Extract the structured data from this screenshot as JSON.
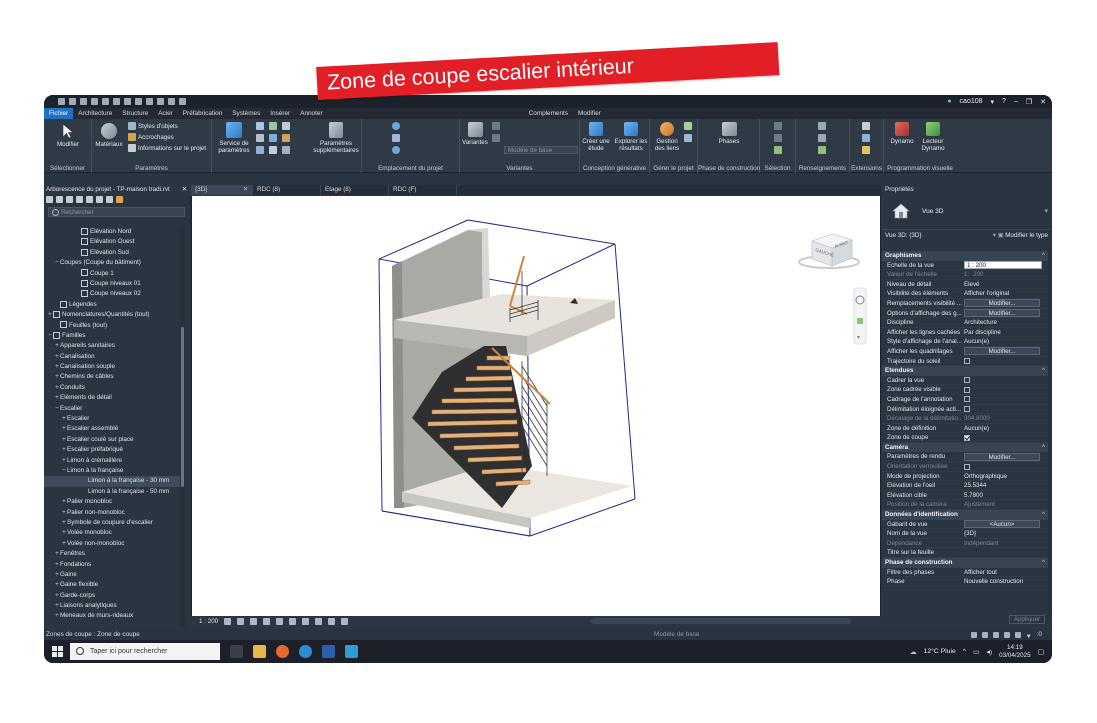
{
  "banner": {
    "text": "Zone de coupe escalier intérieur"
  },
  "titlebar": {
    "user": "cao108"
  },
  "ribbon_tabs": [
    "Fichier",
    "Architecture",
    "Structure",
    "Acier",
    "Préfabrication",
    "Systèmes",
    "Insérer",
    "Annoter",
    "Complements",
    "Modifier"
  ],
  "ribbon": {
    "modifier": "Modifier",
    "materiaux": "Matériaux",
    "styles_objets": "Styles d'objets",
    "accrochages": "Accrochages",
    "infos_projet": "Informations sur le projet",
    "service": "Service de paramètres",
    "params_supp": "Paramètres supplémentaires",
    "variantes": "Variantes",
    "modele_de_base": "Modèle de base",
    "creer_etude": "Créer une étude",
    "explorer": "Explorer les résultats",
    "gestion_liens": "Gestion des liens",
    "phases": "Phases",
    "dynamo": "Dynamo",
    "lecteur_dynamo": "Lecteur Dynamo",
    "panel_labels": {
      "selectionner": "Sélectionner",
      "parametres": "Paramètres",
      "emplacement": "Emplacement du projet",
      "variantes": "Variantes",
      "conception": "Conception générative",
      "gerer_projet": "Gérer le projet",
      "phase": "Phase de construction",
      "selection": "Sélection",
      "renseignements": "Renseignements",
      "extensions": "Extensions",
      "programmation": "Programmation visuelle"
    }
  },
  "browser": {
    "title": "Arborescence du projet - TP-maison tradi.rvt",
    "search_placeholder": "Rechercher",
    "items": [
      {
        "label": "Elévation Nord",
        "indent": 4,
        "exp": "",
        "icon": true
      },
      {
        "label": "Elévation Ouest",
        "indent": 4,
        "exp": "",
        "icon": true
      },
      {
        "label": "Elévation Sud",
        "indent": 4,
        "exp": "",
        "icon": true
      },
      {
        "label": "Coupes (Coupe du bâtiment)",
        "indent": 1,
        "exp": "−",
        "icon": false
      },
      {
        "label": "Coupe 1",
        "indent": 4,
        "exp": "",
        "icon": true
      },
      {
        "label": "Coupe niveaux 01",
        "indent": 4,
        "exp": "",
        "icon": true
      },
      {
        "label": "Coupe niveaux 02",
        "indent": 4,
        "exp": "",
        "icon": true
      },
      {
        "label": "Légendes",
        "indent": 1,
        "exp": "",
        "icon": true
      },
      {
        "label": "Nomenclatures/Quantités (tout)",
        "indent": 0,
        "exp": "+",
        "icon": true
      },
      {
        "label": "Feuilles (tout)",
        "indent": 1,
        "exp": "",
        "icon": true
      },
      {
        "label": "Familles",
        "indent": 0,
        "exp": "−",
        "icon": true
      },
      {
        "label": "Appareils sanitaires",
        "indent": 1,
        "exp": "+",
        "icon": false
      },
      {
        "label": "Canalisation",
        "indent": 1,
        "exp": "+",
        "icon": false
      },
      {
        "label": "Canalisation souple",
        "indent": 1,
        "exp": "+",
        "icon": false
      },
      {
        "label": "Chemins de câbles",
        "indent": 1,
        "exp": "+",
        "icon": false
      },
      {
        "label": "Conduits",
        "indent": 1,
        "exp": "+",
        "icon": false
      },
      {
        "label": "Eléments de détail",
        "indent": 1,
        "exp": "+",
        "icon": false
      },
      {
        "label": "Escalier",
        "indent": 1,
        "exp": "−",
        "icon": false
      },
      {
        "label": "Escalier",
        "indent": 2,
        "exp": "+",
        "icon": false
      },
      {
        "label": "Escalier assemblé",
        "indent": 2,
        "exp": "+",
        "icon": false
      },
      {
        "label": "Escalier coulé sur place",
        "indent": 2,
        "exp": "+",
        "icon": false
      },
      {
        "label": "Escalier préfabriqué",
        "indent": 2,
        "exp": "+",
        "icon": false
      },
      {
        "label": "Limon à crémaillère",
        "indent": 2,
        "exp": "+",
        "icon": false
      },
      {
        "label": "Limon à la française",
        "indent": 2,
        "exp": "−",
        "icon": false
      },
      {
        "label": "Limon à la française - 30 mm",
        "indent": 5,
        "exp": "",
        "icon": false,
        "sel": true
      },
      {
        "label": "Limon à la française - 50 mm",
        "indent": 5,
        "exp": "",
        "icon": false
      },
      {
        "label": "Palier monobloc",
        "indent": 2,
        "exp": "+",
        "icon": false
      },
      {
        "label": "Palier non-monobloc",
        "indent": 2,
        "exp": "+",
        "icon": false
      },
      {
        "label": "Symbole de coupure d'escalier",
        "indent": 2,
        "exp": "+",
        "icon": false
      },
      {
        "label": "Volée monobloc",
        "indent": 2,
        "exp": "+",
        "icon": false
      },
      {
        "label": "Volée non-monobloc",
        "indent": 2,
        "exp": "+",
        "icon": false
      },
      {
        "label": "Fenêtres",
        "indent": 1,
        "exp": "+",
        "icon": false
      },
      {
        "label": "Fondations",
        "indent": 1,
        "exp": "+",
        "icon": false
      },
      {
        "label": "Gaine",
        "indent": 1,
        "exp": "+",
        "icon": false
      },
      {
        "label": "Gaine flexible",
        "indent": 1,
        "exp": "+",
        "icon": false
      },
      {
        "label": "Garde-corps",
        "indent": 1,
        "exp": "+",
        "icon": false
      },
      {
        "label": "Liaisons analytiques",
        "indent": 1,
        "exp": "+",
        "icon": false
      },
      {
        "label": "Meneaux de murs-rideaux",
        "indent": 1,
        "exp": "+",
        "icon": false
      }
    ]
  },
  "view_tabs": [
    "{3D}",
    "RDC (8)",
    "Etage (8)",
    "RDC (F)"
  ],
  "viewcube": {
    "left": "GAUCHE",
    "front": "AVANT"
  },
  "view_scale": "1 : 200",
  "properties": {
    "title": "Propriétés",
    "type_name": "Vue 3D",
    "selector": "Vue 3D: {3D}",
    "edit_type": "Modifier le type",
    "apply": "Appliquer",
    "sections": [
      {
        "name": "Graphismes",
        "rows": [
          {
            "k": "Echelle de la vue",
            "v": "1 : 200",
            "kind": "field"
          },
          {
            "k": "Valeur de l'échelle",
            "v": "200",
            "kind": "dim",
            "pre": "1:"
          },
          {
            "k": "Niveau de détail",
            "v": "Elevé"
          },
          {
            "k": "Visibilité des éléments",
            "v": "Afficher l'original"
          },
          {
            "k": "Remplacements visibilité ...",
            "v": "Modifier...",
            "kind": "btn"
          },
          {
            "k": "Options d'affichage des g...",
            "v": "Modifier...",
            "kind": "btn"
          },
          {
            "k": "Discipline",
            "v": "Architecture"
          },
          {
            "k": "Afficher les lignes cachées",
            "v": "Par discipline"
          },
          {
            "k": "Style d'affichage de l'anal...",
            "v": "Aucun(e)"
          },
          {
            "k": "Afficher les quadrillages",
            "v": "Modifier...",
            "kind": "btn"
          },
          {
            "k": "Trajectoire du soleil",
            "v": "",
            "kind": "cb"
          }
        ]
      },
      {
        "name": "Etendues",
        "rows": [
          {
            "k": "Cadrer la vue",
            "v": "",
            "kind": "cb"
          },
          {
            "k": "Zone cadrée visible",
            "v": "",
            "kind": "cb"
          },
          {
            "k": "Cadrage de l'annotation",
            "v": "",
            "kind": "cb"
          },
          {
            "k": "Délimitation éloignée acti...",
            "v": "",
            "kind": "cb"
          },
          {
            "k": "Décalage de la délimitatio...",
            "v": "304.8000",
            "kind": "dim"
          },
          {
            "k": "Zone de définition",
            "v": "Aucun(e)"
          },
          {
            "k": "Zone de coupe",
            "v": "",
            "kind": "cbon"
          }
        ]
      },
      {
        "name": "Caméra",
        "rows": [
          {
            "k": "Paramètres de rendu",
            "v": "Modifier...",
            "kind": "btn"
          },
          {
            "k": "Orientation verrouillée",
            "v": "",
            "kind": "cbdim"
          },
          {
            "k": "Mode de projection",
            "v": "Orthographique"
          },
          {
            "k": "Elévation de l'oeil",
            "v": "25.5344"
          },
          {
            "k": "Elévation cible",
            "v": "5.7800"
          },
          {
            "k": "Position de la caméra",
            "v": "Ajustement",
            "kind": "dim"
          }
        ]
      },
      {
        "name": "Données d'identification",
        "rows": [
          {
            "k": "Gabarit de vue",
            "v": "<Aucun>",
            "kind": "btn"
          },
          {
            "k": "Nom de la vue",
            "v": "{3D}"
          },
          {
            "k": "Dépendance",
            "v": "Indépendant",
            "kind": "dim"
          },
          {
            "k": "Titre sur la feuille",
            "v": ""
          }
        ]
      },
      {
        "name": "Phase de construction",
        "rows": [
          {
            "k": "Filtre des phases",
            "v": "Afficher tout"
          },
          {
            "k": "Phase",
            "v": "Nouvelle construction"
          }
        ]
      }
    ]
  },
  "status": {
    "text": "Zones de coupe : Zone de coupe",
    "model": "Modèle de base",
    "filter": ":0"
  },
  "taskbar": {
    "search": "Taper ici pour rechercher",
    "weather": "12°C  Pluie",
    "time": "14:19",
    "date": "03/04/2025"
  }
}
